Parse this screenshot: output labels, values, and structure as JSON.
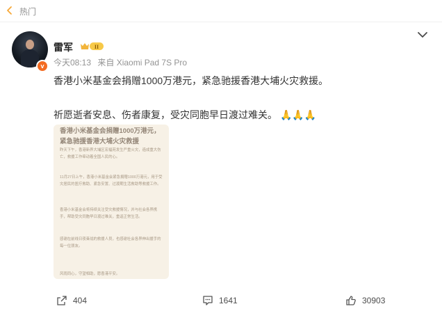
{
  "header": {
    "section_label": "热门"
  },
  "post": {
    "author": "雷军",
    "badge_text": "II",
    "time": "今天08:13",
    "source": "来自 Xiaomi Pad 7S Pro",
    "text_line1": "香港小米基金会捐赠1000万港元，紧急驰援香港大埔火灾救援。",
    "text_line2": "祈愿逝者安息、伤者康复，受灾同胞早日渡过难关。",
    "emoji": "🙏🙏🙏",
    "verified_mark": "v"
  },
  "attachment": {
    "title": "香港小米基金会捐赠1000万港元，紧急驰援香港大埔火灾救援",
    "paragraphs": [
      "昨天下午，香港新界大埔区宏福苑发生严重火灾，造成重大伤亡，救援工作牵动着全国人民的心。",
      "11月27日上午，香港小米基金会紧急捐赠1000万港元，用于受灾居民的医疗救助、紧急安置、过渡期生活救助等救援工作。",
      "香港小米基金会将持续关注受灾救援情况，并与社会各界携手，帮助受灾同胞早日渡过难关，重返正常生活。",
      "感谢在前线日夜奋战的救援人员，也感谢社会各界伸出援手的每一位朋友。",
      "风雨同心，守望相助，愿香港平安。"
    ]
  },
  "actions": {
    "repost_count": "404",
    "comment_count": "1641",
    "like_count": "30903"
  }
}
